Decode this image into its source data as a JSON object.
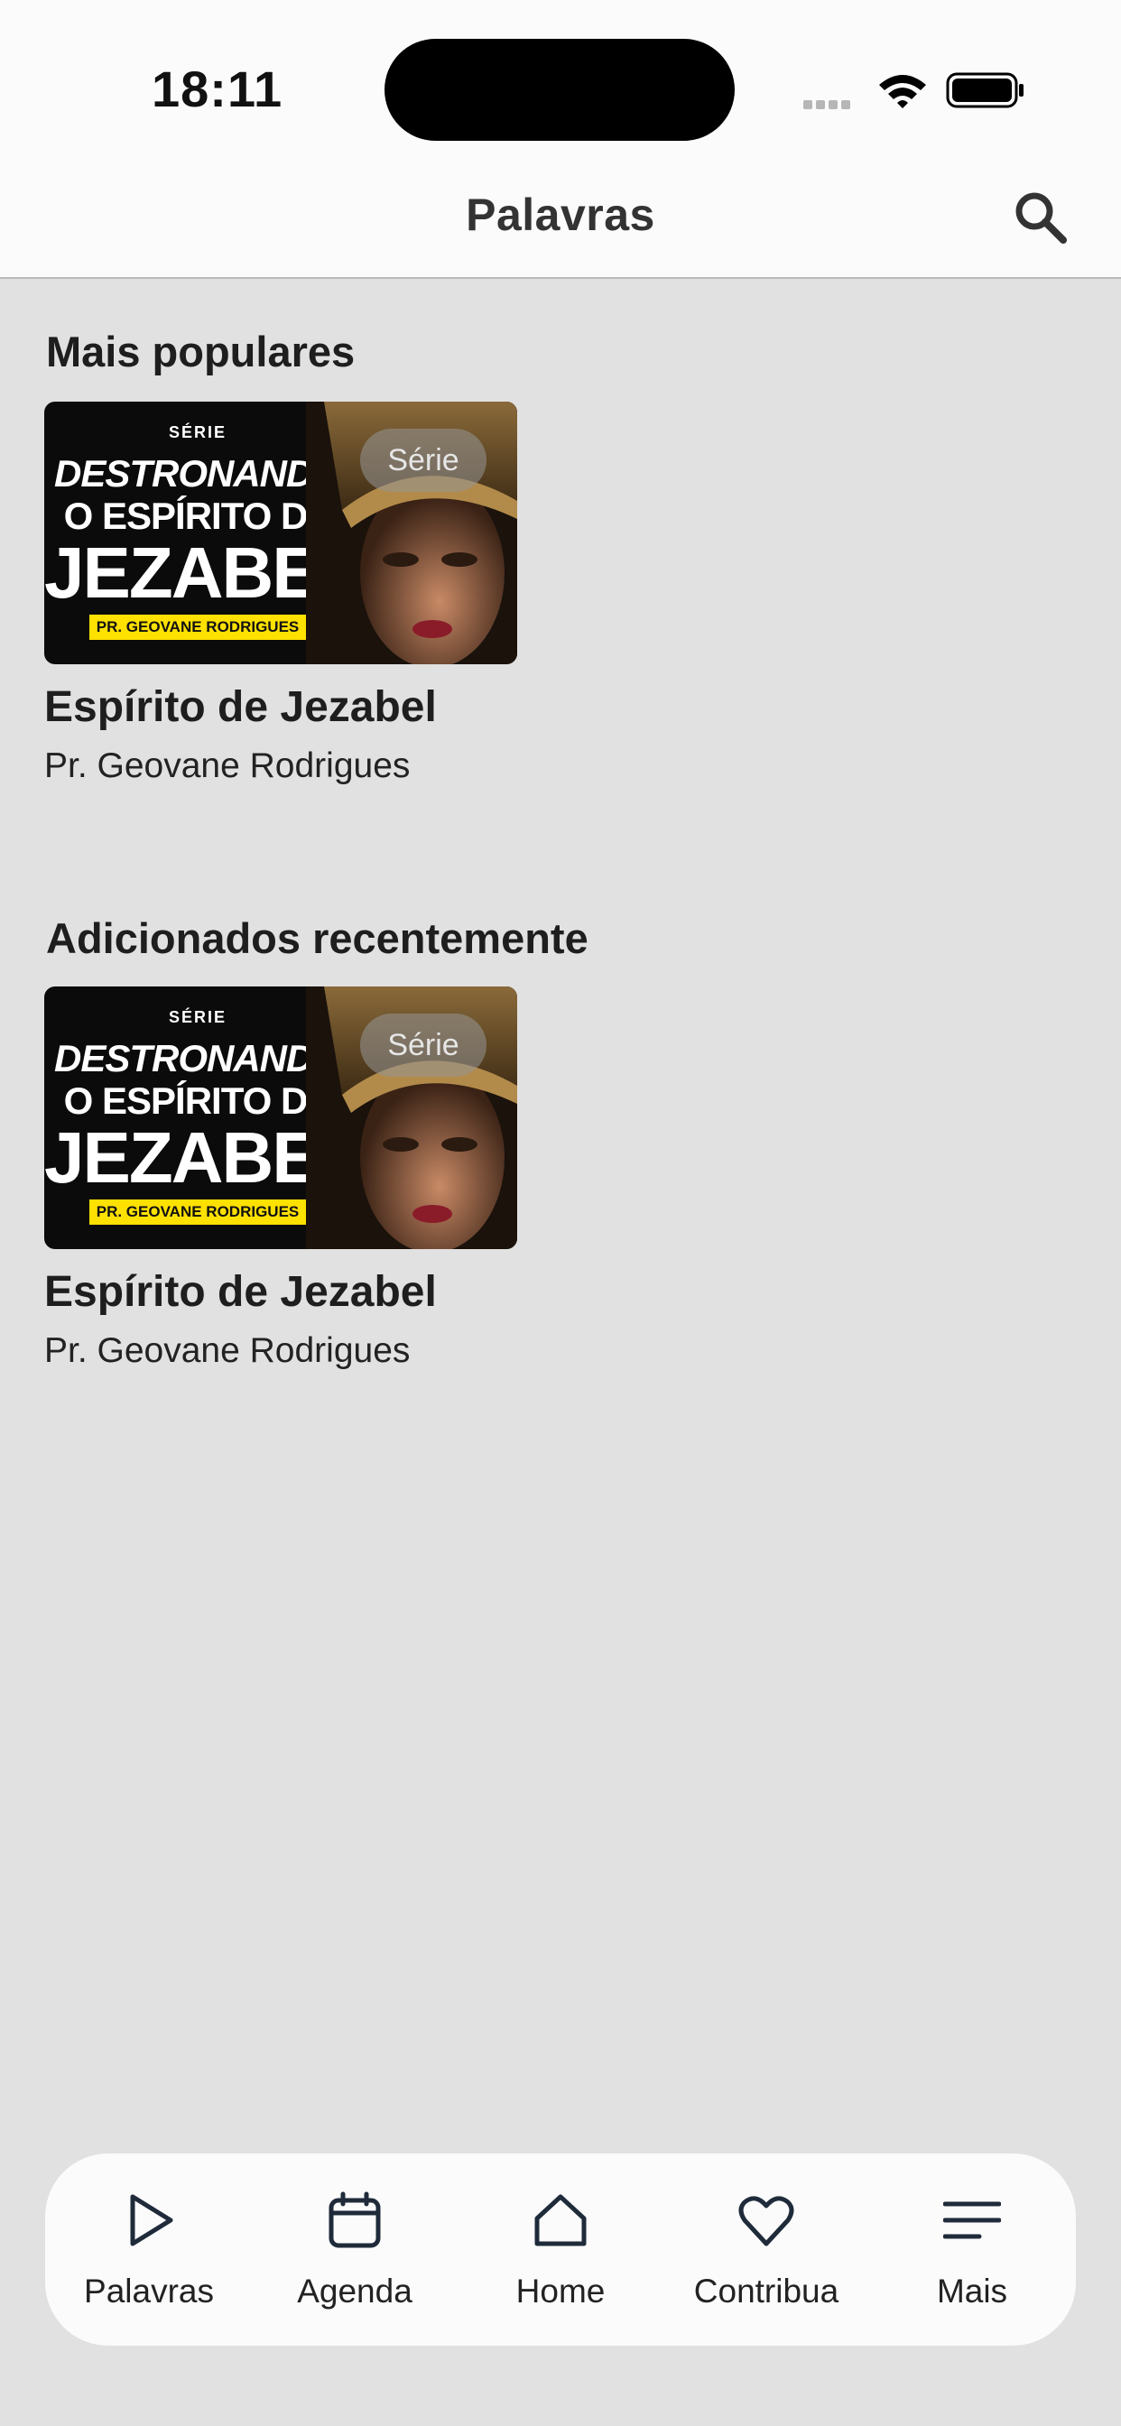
{
  "status_bar": {
    "time": "18:11"
  },
  "nav": {
    "title": "Palavras"
  },
  "sections": [
    {
      "title": "Mais populares",
      "card": {
        "badge": "Série",
        "title": "Espírito de Jezabel",
        "subtitle": "Pr. Geovane Rodrigues",
        "thumb": {
          "serie": "SÉRIE",
          "line1": "DESTRONANDO",
          "line2": "O ESPÍRITO DE",
          "line3": "JEZABEL",
          "author": "PR. GEOVANE RODRIGUES"
        }
      }
    },
    {
      "title": "Adicionados recentemente",
      "card": {
        "badge": "Série",
        "title": "Espírito de Jezabel",
        "subtitle": "Pr. Geovane Rodrigues",
        "thumb": {
          "serie": "SÉRIE",
          "line1": "DESTRONANDO",
          "line2": "O ESPÍRITO DE",
          "line3": "JEZABEL",
          "author": "PR. GEOVANE RODRIGUES"
        }
      }
    }
  ],
  "tabbar": {
    "items": [
      {
        "label": "Palavras",
        "icon": "play-icon"
      },
      {
        "label": "Agenda",
        "icon": "calendar-icon"
      },
      {
        "label": "Home",
        "icon": "home-icon"
      },
      {
        "label": "Contribua",
        "icon": "heart-icon"
      },
      {
        "label": "Mais",
        "icon": "menu-icon"
      }
    ]
  },
  "colors": {
    "background": "#e1e1e1",
    "bar": "#fbfbfb",
    "thumb_author_band": "#ffe100"
  }
}
